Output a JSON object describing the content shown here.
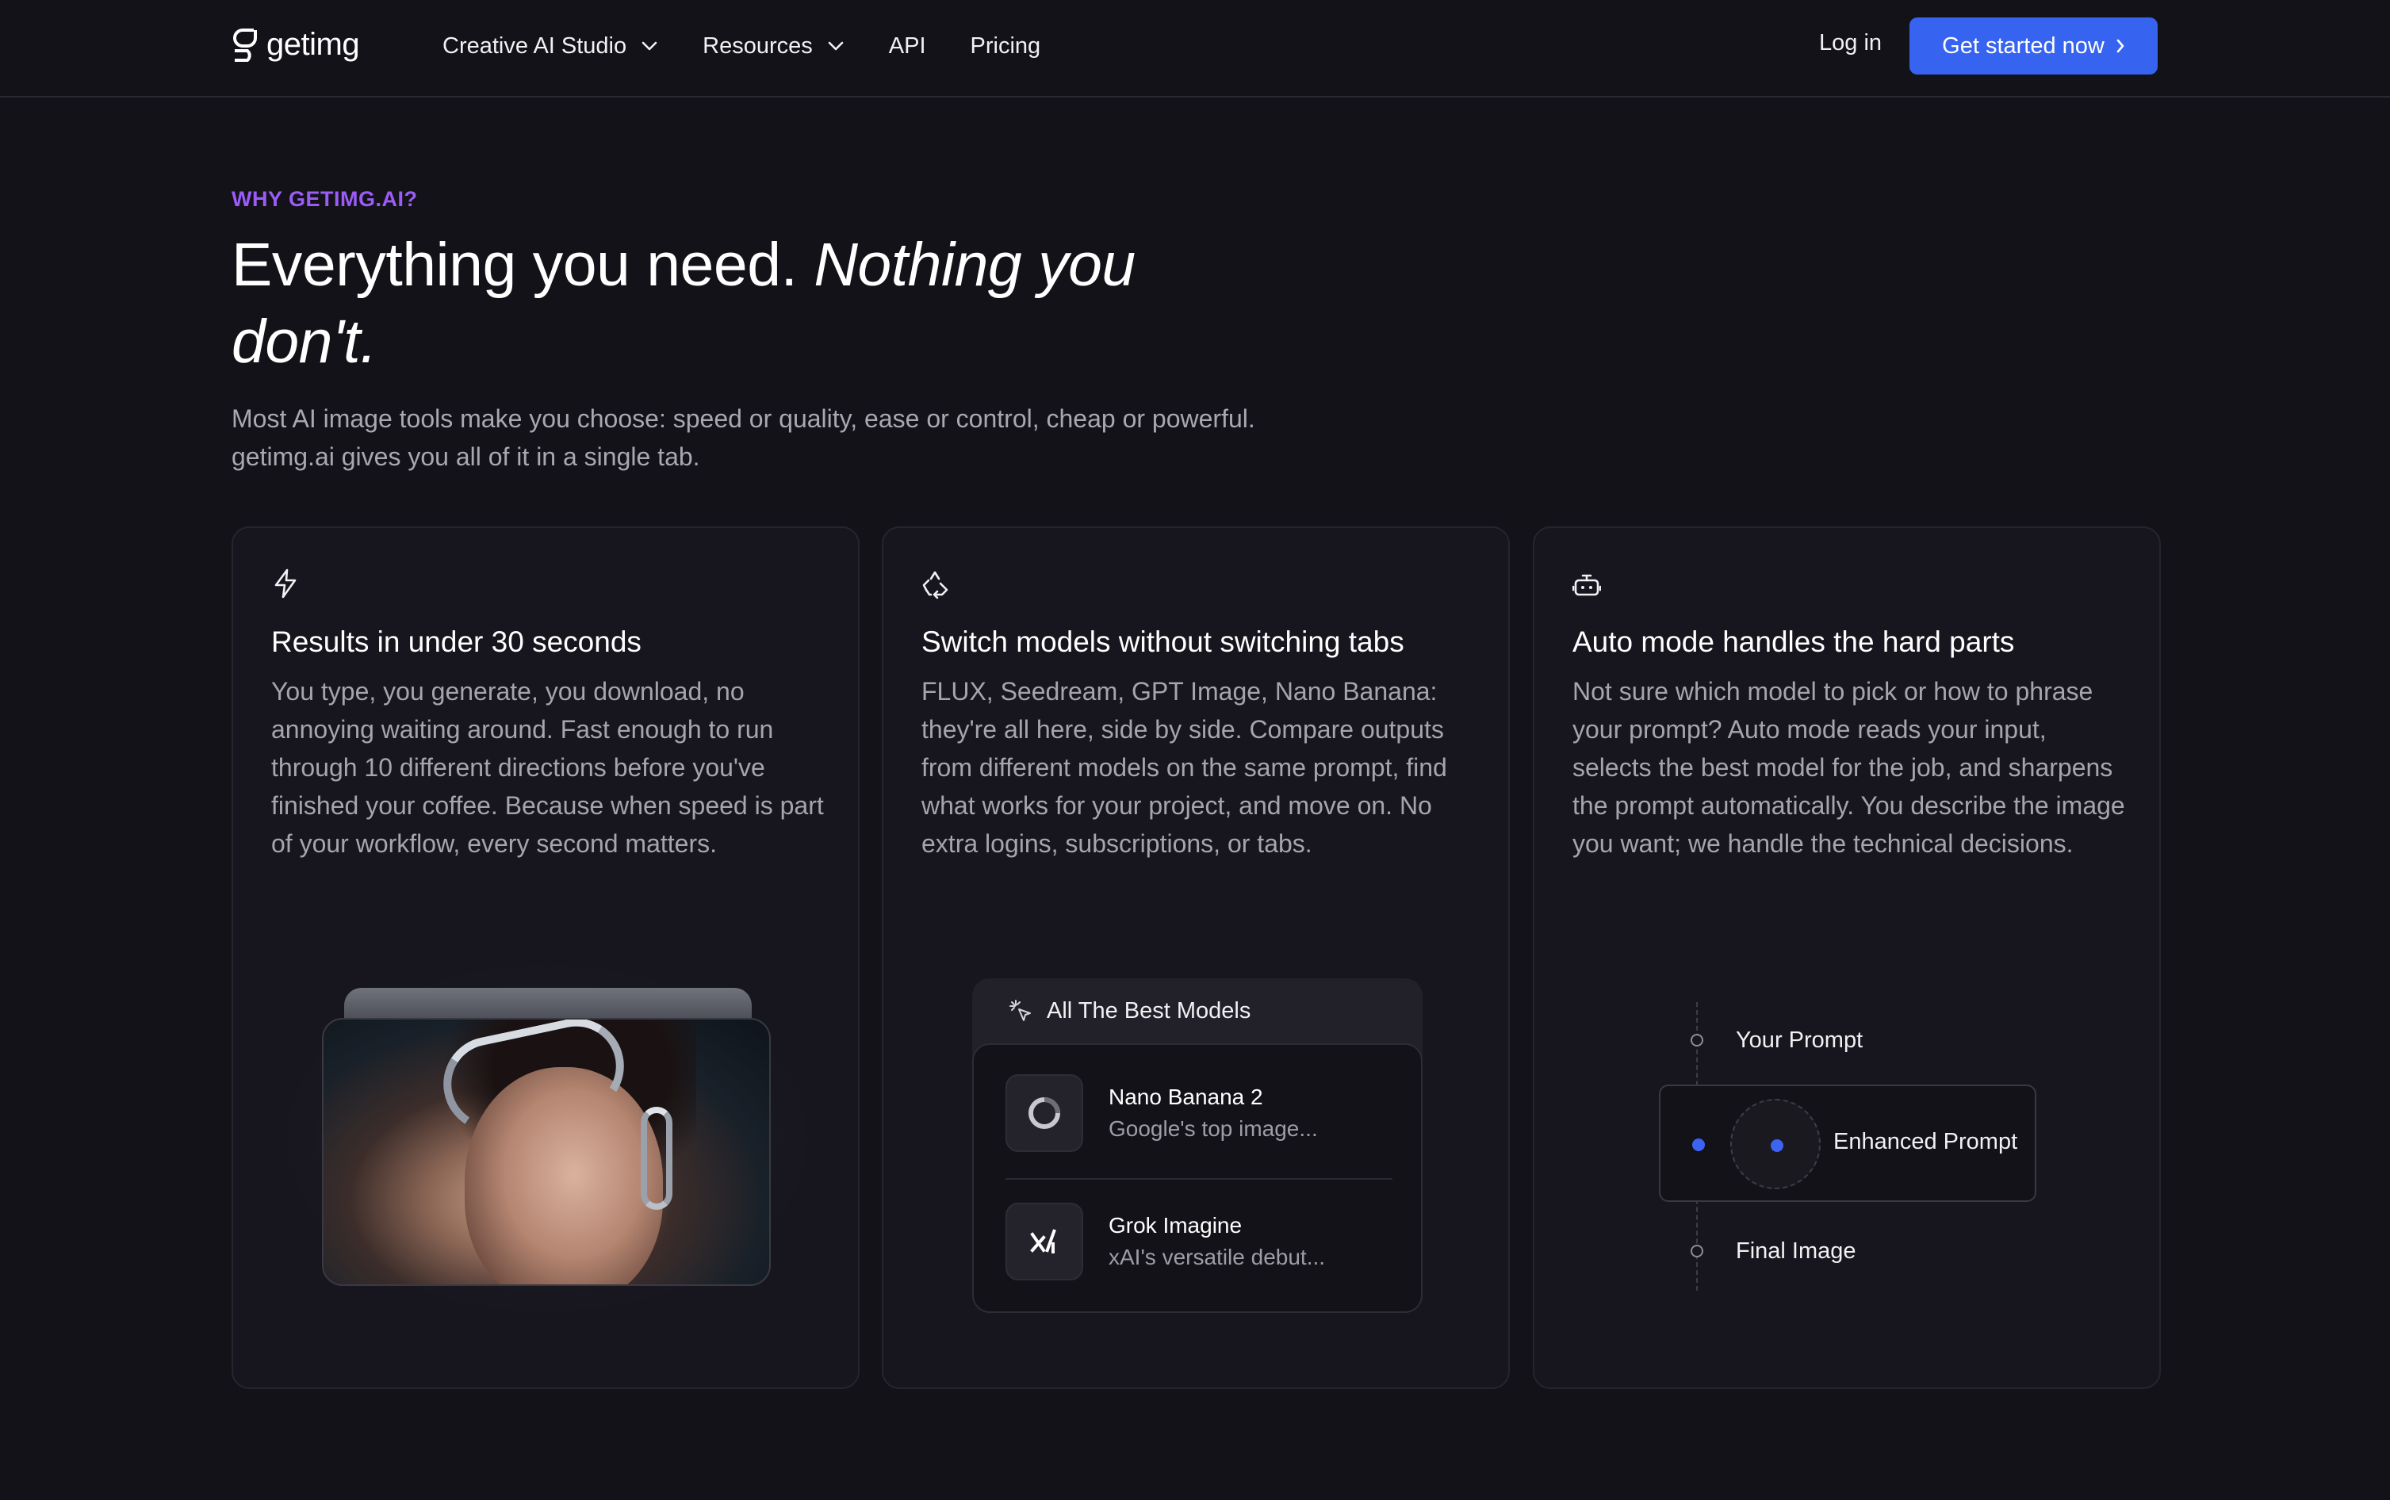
{
  "nav": {
    "logo_text": "getimg",
    "links": [
      {
        "label": "Creative AI Studio",
        "has_dropdown": true
      },
      {
        "label": "Resources",
        "has_dropdown": true
      },
      {
        "label": "API",
        "has_dropdown": false
      },
      {
        "label": "Pricing",
        "has_dropdown": false
      }
    ],
    "login_label": "Log in",
    "cta_label": "Get started now"
  },
  "hero": {
    "eyebrow": "WHY GETIMG.AI?",
    "headline_regular": "Everything you need. ",
    "headline_italic": "Nothing you don't.",
    "subhead": "Most AI image tools make you choose: speed or quality, ease or control, cheap or powerful. getimg.ai gives you all of it in a single tab."
  },
  "cards": [
    {
      "icon": "lightning-icon",
      "title": "Results in under 30 seconds",
      "body": "You type, you generate, you download, no annoying waiting around. Fast enough to run through 10 different directions before you've finished your coffee. Because when speed is part of your workflow, every second matters."
    },
    {
      "icon": "recycle-icon",
      "title": "Switch models without switching tabs",
      "body": "FLUX, Seedream, GPT Image, Nano Banana: they're all here, side by side. Compare outputs from different models on the same prompt, find what works for your project, and move on. No extra logins, subscriptions, or tabs.",
      "panel": {
        "header": "All The Best Models",
        "models": [
          {
            "name": "Nano Banana 2",
            "desc": "Google's top image...",
            "icon": "gemini-swirl-icon"
          },
          {
            "name": "Grok Imagine",
            "desc": "xAI's versatile debut...",
            "icon": "xai-logo-icon"
          }
        ]
      }
    },
    {
      "icon": "robot-icon",
      "title": "Auto mode handles the hard parts",
      "body": "Not sure which model to pick or how to phrase your prompt? Auto mode reads your input, selects the best model for the job, and sharpens the prompt automatically. You describe the image you want; we handle the technical decisions.",
      "flow": {
        "step1": "Your Prompt",
        "step2": "Enhanced Prompt",
        "step3": "Final Image"
      }
    }
  ],
  "colors": {
    "background": "#131219",
    "accent_blue": "#3663f0",
    "eyebrow_purple": "#9b5cf6"
  }
}
